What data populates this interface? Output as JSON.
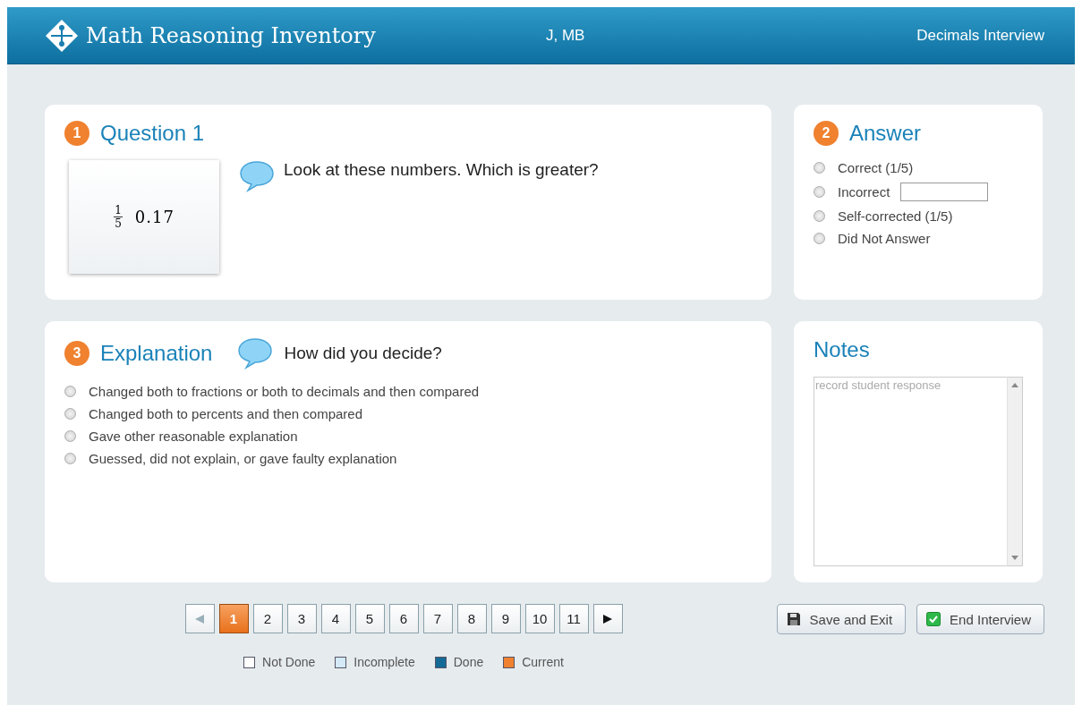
{
  "header": {
    "app_title": "Math Reasoning Inventory",
    "student": "J, MB",
    "interview": "Decimals Interview"
  },
  "question": {
    "step": "1",
    "title": "Question 1",
    "prompt": "Look at these numbers. Which is greater?",
    "card": {
      "numerator": "1",
      "denominator": "5",
      "decimal": "0.17"
    }
  },
  "answer": {
    "step": "2",
    "title": "Answer",
    "options": [
      {
        "label": "Correct (1/5)",
        "kind": "plain",
        "selected": false
      },
      {
        "label": "Incorrect",
        "kind": "with-field",
        "selected": false
      },
      {
        "label": "Self-corrected (1/5)",
        "kind": "plain",
        "selected": false
      },
      {
        "label": "Did Not Answer",
        "kind": "plain",
        "selected": false
      }
    ]
  },
  "explanation": {
    "step": "3",
    "title": "Explanation",
    "prompt": "How did you decide?",
    "options": [
      {
        "label": "Changed both to fractions or both to decimals and then compared",
        "selected": false
      },
      {
        "label": "Changed both to percents and then compared",
        "selected": false
      },
      {
        "label": "Gave other reasonable explanation",
        "selected": false
      },
      {
        "label": "Guessed, did not explain, or gave faulty explanation",
        "selected": false
      }
    ]
  },
  "notes": {
    "title": "Notes",
    "placeholder": "record student response"
  },
  "pager": {
    "prev_disabled": true,
    "next_disabled": false,
    "pages": [
      {
        "label": "1",
        "selected": true
      },
      {
        "label": "2",
        "selected": false
      },
      {
        "label": "3",
        "selected": false
      },
      {
        "label": "4",
        "selected": false
      },
      {
        "label": "5",
        "selected": false
      },
      {
        "label": "6",
        "selected": false
      },
      {
        "label": "7",
        "selected": false
      },
      {
        "label": "8",
        "selected": false
      },
      {
        "label": "9",
        "selected": false
      },
      {
        "label": "10",
        "selected": false
      },
      {
        "label": "11",
        "selected": false
      }
    ]
  },
  "legend": [
    {
      "label": "Not Done",
      "color": "#ffffff"
    },
    {
      "label": "Incomplete",
      "color": "#d4eaf7"
    },
    {
      "label": "Done",
      "color": "#146a96"
    },
    {
      "label": "Current",
      "color": "#f0812f"
    }
  ],
  "buttons": [
    {
      "label": "Save and Exit",
      "kind": "save"
    },
    {
      "label": "End Interview",
      "kind": "end"
    }
  ]
}
